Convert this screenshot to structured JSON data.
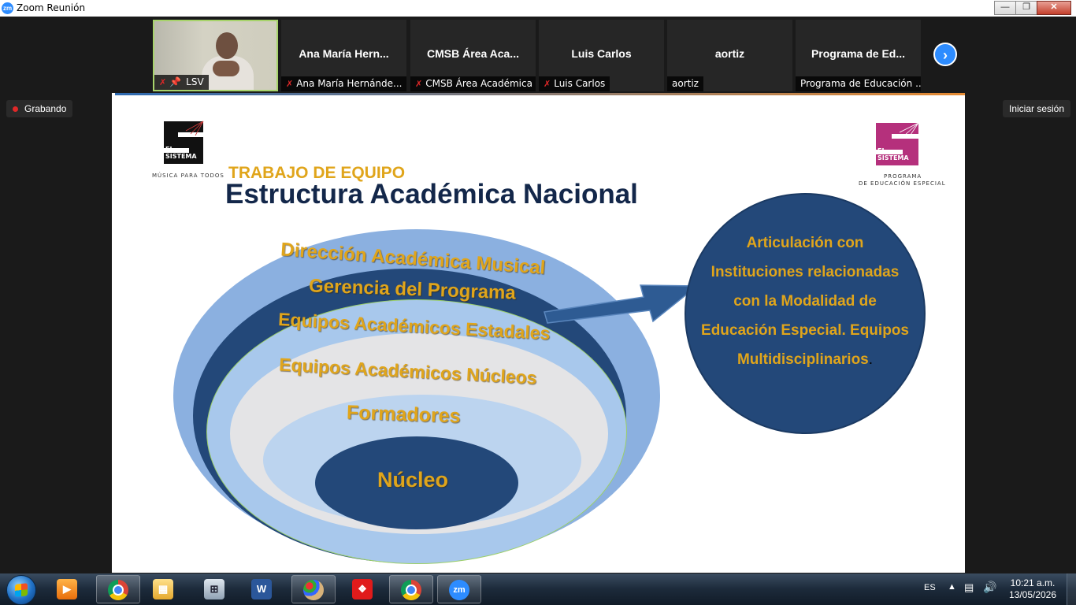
{
  "window": {
    "title": "Zoom Reunión",
    "app_icon": "zm"
  },
  "participants": [
    {
      "name": "",
      "label": "LSV",
      "muted": true,
      "pinned": true,
      "video": true
    },
    {
      "name": "Ana María Hern...",
      "label": "Ana María Hernánde...",
      "muted": true
    },
    {
      "name": "CMSB Área Aca...",
      "label": "CMSB Área Académica",
      "muted": true
    },
    {
      "name": "Luis Carlos",
      "label": "Luis Carlos",
      "muted": true
    },
    {
      "name": "aortiz",
      "label": "aortiz",
      "muted": false
    },
    {
      "name": "Programa de Ed...",
      "label": "Programa de Educación ...",
      "muted": false
    }
  ],
  "next_icon": "chevron-right-icon",
  "recording": {
    "label": "Grabando",
    "color": "#e02828"
  },
  "signin_label": "Iniciar sesión",
  "slide": {
    "logo_left": {
      "text1": "EL",
      "text2": "SISTEMA",
      "tagline": "MÚSICA PARA TODOS"
    },
    "logo_right": {
      "text1": "EL",
      "text2": "SISTEMA",
      "tagline1": "PROGRAMA",
      "tagline2": "DE EDUCACIÓN ESPECIAL",
      "color": "#b5307c"
    },
    "subtitle": "TRABAJO DE EQUIPO",
    "title": "Estructura Académica Nacional",
    "rings": [
      "Dirección Académica Musical",
      "Gerencia del Programa",
      "Equipos Académicos Estadales",
      "Equipos Académicos Núcleos",
      "Formadores",
      "Núcleo"
    ],
    "circle_lines": [
      "Articulación con",
      "Instituciones relacionadas",
      "con la Modalidad de",
      "Educación Especial. Equipos",
      "Multidisciplinarios"
    ],
    "circle_end": ".",
    "accent_gold": "#e0a51b",
    "navy": "#13274a"
  },
  "taskbar": {
    "items": [
      {
        "name": "media-player-icon",
        "open": false
      },
      {
        "name": "chrome-icon",
        "open": true
      },
      {
        "name": "file-explorer-icon",
        "open": false
      },
      {
        "name": "calculator-icon",
        "open": false
      },
      {
        "name": "word-icon",
        "open": false,
        "glyph": "W"
      },
      {
        "name": "paint-icon",
        "open": true
      },
      {
        "name": "acrobat-icon",
        "open": false
      },
      {
        "name": "chrome-icon",
        "open": true
      },
      {
        "name": "zoom-icon",
        "open": true,
        "glyph": "zm"
      }
    ],
    "language": "ES",
    "time": "10:21 a.m.",
    "date": "13/05/2026"
  }
}
